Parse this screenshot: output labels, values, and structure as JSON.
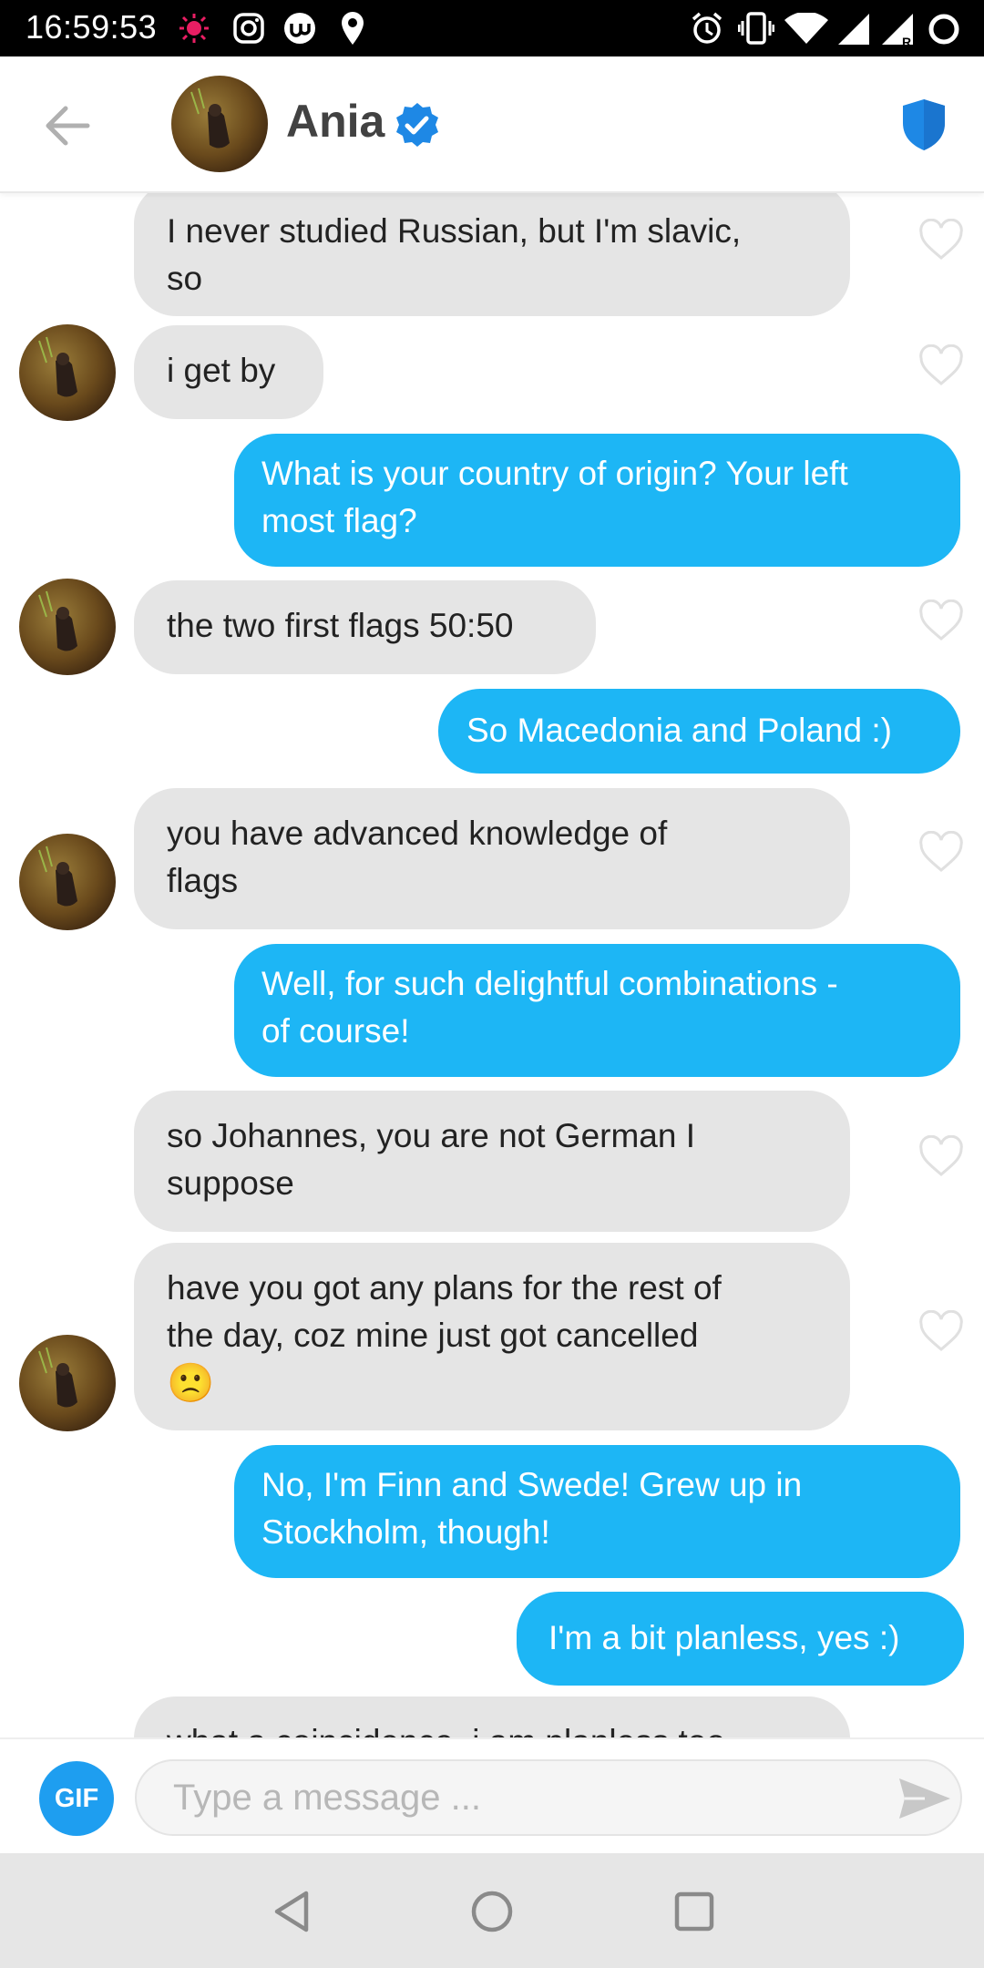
{
  "status_bar": {
    "time": "16:59:53",
    "icons": [
      "notification-dot-icon",
      "instagram-icon",
      "app-icon",
      "location-icon",
      "alarm-icon",
      "vibrate-icon",
      "wifi-icon",
      "signal-icon",
      "signal-roaming-icon",
      "battery-icon"
    ],
    "accent": "#e91e63"
  },
  "header": {
    "back_icon": "arrow-left-icon",
    "contact_name": "Ania",
    "verified_icon": "verified-badge-icon",
    "safety_icon": "shield-icon",
    "accent": "#1e88e5"
  },
  "messages": [
    {
      "side": "in",
      "text_lines": [
        "I never studied Russian, but I'm slavic,",
        "so"
      ]
    },
    {
      "side": "in",
      "text_lines": [
        "i get by"
      ]
    },
    {
      "side": "out",
      "text_lines": [
        "What is your country of origin? Your left",
        "most flag?"
      ]
    },
    {
      "side": "in",
      "text_lines": [
        "the two first flags 50:50"
      ]
    },
    {
      "side": "out",
      "text_lines": [
        "So Macedonia and Poland :)"
      ]
    },
    {
      "side": "in",
      "text_lines": [
        "you have advanced knowledge of",
        "flags"
      ]
    },
    {
      "side": "out",
      "text_lines": [
        "Well, for such delightful combinations -",
        "of course!"
      ]
    },
    {
      "side": "in",
      "text_lines": [
        "so Johannes, you are not German I",
        "suppose"
      ]
    },
    {
      "side": "in",
      "text_lines": [
        "have you got any plans for the rest of",
        "the day, coz mine just got cancelled"
      ],
      "emoji": "🙁"
    },
    {
      "side": "out",
      "text_lines": [
        "No, I'm Finn and Swede! Grew up in",
        "Stockholm, though!"
      ]
    },
    {
      "side": "out",
      "text_lines": [
        "I'm a bit planless, yes :)"
      ]
    },
    {
      "side": "in",
      "text_lines": [
        "what a coincidence, i am planless too"
      ]
    }
  ],
  "composer": {
    "gif_label": "GIF",
    "placeholder": "Type a message ...",
    "send_icon": "send-icon"
  },
  "nav_bar": {
    "icons": [
      "back-triangle-icon",
      "home-circle-icon",
      "recents-square-icon"
    ]
  },
  "colors": {
    "outgoing_bubble": "#1db6f5",
    "incoming_bubble": "#e5e5e5",
    "gif_button": "#1e9ef0"
  }
}
